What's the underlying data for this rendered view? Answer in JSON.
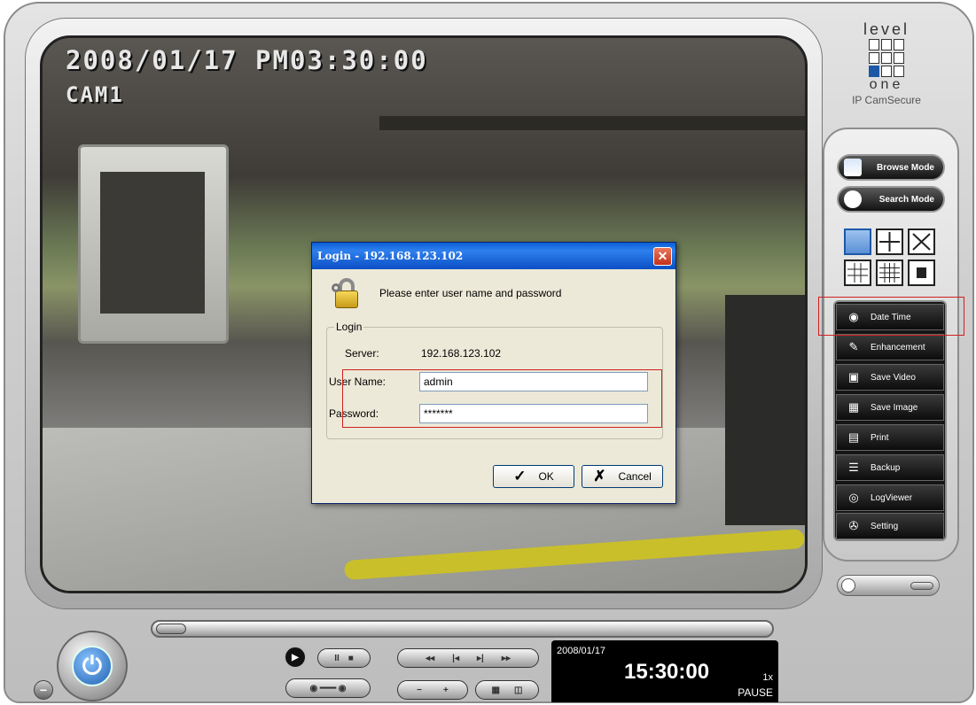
{
  "video": {
    "osd_timestamp": "2008/01/17 PM03:30:00",
    "osd_camera": "CAM1"
  },
  "login_dialog": {
    "title": "Login - 192.168.123.102",
    "close_glyph": "✕",
    "message": "Please enter user name and password",
    "group_label": "Login",
    "server_label": "Server:",
    "server_value": "192.168.123.102",
    "username_label": "User Name:",
    "username_value": "admin",
    "password_label": "Password:",
    "password_value": "*******",
    "ok_label": "OK",
    "ok_glyph": "✓",
    "cancel_label": "Cancel",
    "cancel_glyph": "✗"
  },
  "brand": {
    "top": "level",
    "bottom": "one",
    "subtitle": "IP CamSecure"
  },
  "modes": [
    {
      "label": "Browse Mode",
      "icon": "folder-icon"
    },
    {
      "label": "Search Mode",
      "icon": "search-person-icon"
    }
  ],
  "layouts": [
    {
      "icon": "single-view-icon",
      "active": true
    },
    {
      "icon": "quad-view-icon",
      "active": false
    },
    {
      "icon": "fullscreen-icon",
      "active": false
    },
    {
      "icon": "nine-view-icon",
      "active": false
    },
    {
      "icon": "sixteen-view-icon",
      "active": false
    },
    {
      "icon": "fit-view-icon",
      "active": false
    }
  ],
  "functions": [
    {
      "label": "Date Time",
      "icon": "clock-icon",
      "glyph": "◉"
    },
    {
      "label": "Enhancement",
      "icon": "pencil-icon",
      "glyph": "✎"
    },
    {
      "label": "Save Video",
      "icon": "save-video-icon",
      "glyph": "▣"
    },
    {
      "label": "Save Image",
      "icon": "save-image-icon",
      "glyph": "▦"
    },
    {
      "label": "Print",
      "icon": "printer-icon",
      "glyph": "▤"
    },
    {
      "label": "Backup",
      "icon": "backup-icon",
      "glyph": "☰"
    },
    {
      "label": "LogViewer",
      "icon": "eye-icon",
      "glyph": "◎"
    },
    {
      "label": "Setting",
      "icon": "wrench-icon",
      "glyph": "✇"
    }
  ],
  "playback": {
    "date": "2008/01/17",
    "time": "15:30:00",
    "speed": "1x",
    "state": "PAUSE",
    "timeline_position": 0.01
  },
  "controls": {
    "rewind_glyph": "◂◂",
    "prev_glyph": "|◂",
    "next_glyph": "▸|",
    "forward_glyph": "▸▸",
    "minus_glyph": "−",
    "plus_glyph": "+",
    "pause_glyph": "II",
    "stop_glyph": "■",
    "play_glyph": "▶"
  },
  "colors": {
    "highlight": "#d02020",
    "titlebar": "#0a5fd8",
    "brand_blue": "#1d58a6"
  }
}
